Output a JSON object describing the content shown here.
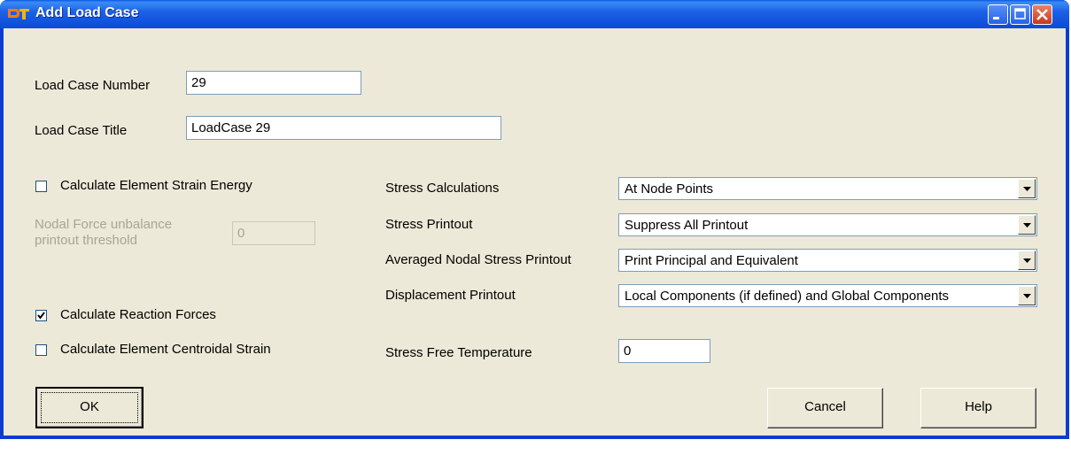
{
  "window": {
    "title": "Add Load Case"
  },
  "load_case": {
    "number_label": "Load Case Number",
    "number_value": "29",
    "title_label": "Load Case Title",
    "title_value": "LoadCase 29"
  },
  "options": {
    "strain_energy": {
      "label": "Calculate Element Strain Energy",
      "checked": false
    },
    "nodal_force": {
      "label_line1": "Nodal Force unbalance",
      "label_line2": "printout threshold",
      "value": "0",
      "enabled": false
    },
    "reaction_forces": {
      "label": "Calculate Reaction Forces",
      "checked": true
    },
    "centroidal_strain": {
      "label": "Calculate Element Centroidal Strain",
      "checked": false
    }
  },
  "stress": {
    "calculations": {
      "label": "Stress Calculations",
      "value": "At Node Points"
    },
    "printout": {
      "label": "Stress Printout",
      "value": "Suppress All Printout"
    },
    "averaged": {
      "label": "Averaged Nodal Stress Printout",
      "value": "Print Principal and Equivalent"
    },
    "displacement": {
      "label": "Displacement Printout",
      "value": "Local Components (if defined) and Global Components"
    },
    "free_temp": {
      "label": "Stress Free Temperature",
      "value": "0"
    }
  },
  "buttons": {
    "ok": "OK",
    "cancel": "Cancel",
    "help": "Help"
  },
  "icons": [
    "app-icon",
    "minimize-icon",
    "maximize-icon",
    "close-icon",
    "checkmark-icon",
    "dropdown-arrow-icon"
  ]
}
